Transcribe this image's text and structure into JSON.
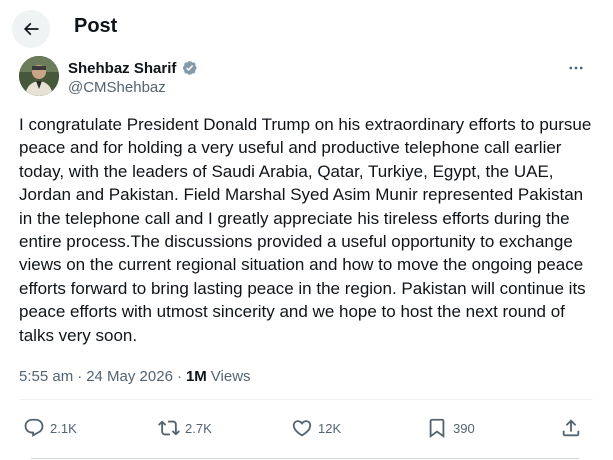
{
  "header": {
    "title": "Post",
    "back_icon": "arrow-left-icon"
  },
  "author": {
    "name": "Shehbaz Sharif",
    "handle": "@CMShehbaz",
    "verified": true,
    "verified_color": "#829aab",
    "avatar": "profile-photo"
  },
  "post": {
    "text": "I congratulate President Donald Trump on his extraordinary efforts to pursue peace and for holding a very useful and productive telephone call earlier today, with the leaders of Saudi Arabia, Qatar, Turkiye, Egypt, the UAE, Jordan and Pakistan. Field Marshal Syed Asim Munir represented Pakistan in the telephone call and I greatly appreciate his tireless efforts during the entire process.The discussions provided a useful opportunity to exchange views on the current regional situation and how to move the ongoing peace efforts forward to bring lasting peace in the region. Pakistan will continue its peace efforts with utmost sincerity and we hope to host the next round of talks very soon.",
    "time": "5:55 am",
    "separator": "·",
    "date": "24 May 2026",
    "views_count": "1M",
    "views_label": "Views"
  },
  "actions": {
    "replies": "2.1K",
    "reposts": "2.7K",
    "likes": "12K",
    "bookmarks": "390"
  },
  "colors": {
    "text": "#0f1419",
    "secondary": "#536471",
    "back_button_bg": "#eff3f4"
  }
}
